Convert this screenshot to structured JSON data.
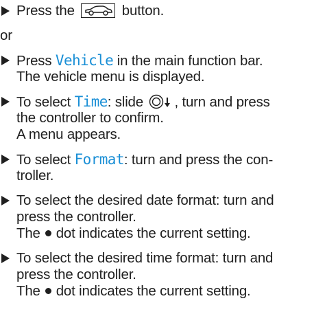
{
  "steps": [
    {
      "pre": "Press the",
      "post": "button.",
      "icon": "car-button-icon"
    },
    {
      "separator": "or"
    },
    {
      "pre": "Press",
      "ui": "Vehicle",
      "post": "in the main function bar.",
      "note": "The vehicle menu is displayed."
    },
    {
      "pre": "To select",
      "ui": "Time",
      "mid": ": slide",
      "post": ", turn and press",
      "line2": "the controller to confirm.",
      "note": "A menu appears.",
      "icon": "controller-slide-down-icon"
    },
    {
      "pre": "To select",
      "ui": "Format",
      "post": ": turn and press the con-",
      "line2": "troller."
    },
    {
      "line1": "To select the desired date format: turn and",
      "line2": "press the controller.",
      "note_pre": "The",
      "note_post": "dot indicates the current setting.",
      "icon": "dot-icon"
    },
    {
      "line1": "To select the desired time format: turn and",
      "line2": "press the controller.",
      "note_pre": "The",
      "note_post": "dot indicates the current setting.",
      "icon": "dot-icon"
    }
  ]
}
